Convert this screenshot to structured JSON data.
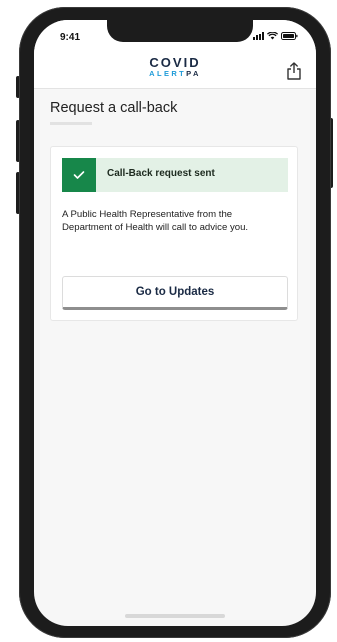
{
  "status_bar": {
    "time": "9:41",
    "icons": [
      "signal-icon",
      "wifi-icon",
      "battery-icon"
    ]
  },
  "app_bar": {
    "logo_top": "COVID",
    "logo_bottom_prefix": "ALERT",
    "logo_bottom_suffix": "PA",
    "share_icon": "share-icon"
  },
  "page": {
    "title": "Request a call-back"
  },
  "card": {
    "alert_icon": "check-icon",
    "alert_text": "Call-Back request sent",
    "body_text": "A Public Health Representative from the Department of Health will call to advice you.",
    "button_label": "Go to Updates"
  },
  "colors": {
    "success_green": "#17874a",
    "success_bg": "#e3f1e6",
    "brand_navy": "#1a2a44",
    "brand_blue": "#1f9bd8"
  }
}
